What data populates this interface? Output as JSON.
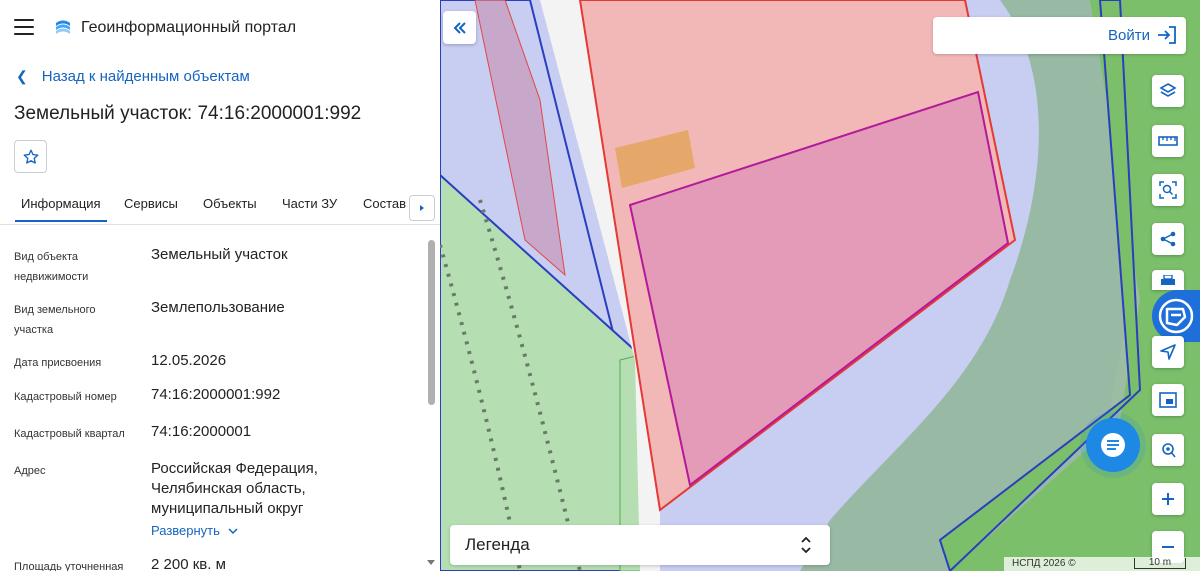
{
  "header": {
    "app_title": "Геоинформационный портал"
  },
  "back_link": "Назад к найденным объектам",
  "page_title": "Земельный участок: 74:16:2000001:992",
  "tabs": [
    {
      "label": "Информация",
      "active": true
    },
    {
      "label": "Сервисы"
    },
    {
      "label": "Объекты"
    },
    {
      "label": "Части ЗУ"
    },
    {
      "label": "Состав"
    }
  ],
  "fields": [
    {
      "label": "Вид объекта недвижимости",
      "value": "Земельный участок"
    },
    {
      "label": "Вид земельного участка",
      "value": "Землепользование"
    },
    {
      "label": "Дата присвоения",
      "value": "12.05.2026"
    },
    {
      "label": "Кадастровый номер",
      "value": "74:16:2000001:992"
    },
    {
      "label": "Кадастровый квартал",
      "value": "74:16:2000001"
    },
    {
      "label": "Адрес",
      "value": "Российская Федерация, Челябинская область, муниципальный округ",
      "expand": "Развернуть"
    },
    {
      "label": "Площадь уточненная",
      "value": "2 200 кв. м"
    }
  ],
  "map": {
    "login_label": "Войти",
    "legend_label": "Легенда",
    "attribution": "НСПД 2026 ©",
    "scale": "10 m",
    "tools": [
      "layers-icon",
      "ruler-icon",
      "area-search-icon",
      "share-icon",
      "print-icon",
      "nspd-logo-icon",
      "navigate-icon",
      "picture-in-picture-icon",
      "locate-icon",
      "zoom-in-icon",
      "zoom-out-icon"
    ]
  },
  "colors": {
    "accent": "#1565c0",
    "parcel_fill": "#e39bb8",
    "parcel_stroke": "#b4199a",
    "zone_fill": "#f2b8b8",
    "zone_stroke": "#e53935",
    "water": "#c8cdf2",
    "green": "#7bbf6a"
  }
}
